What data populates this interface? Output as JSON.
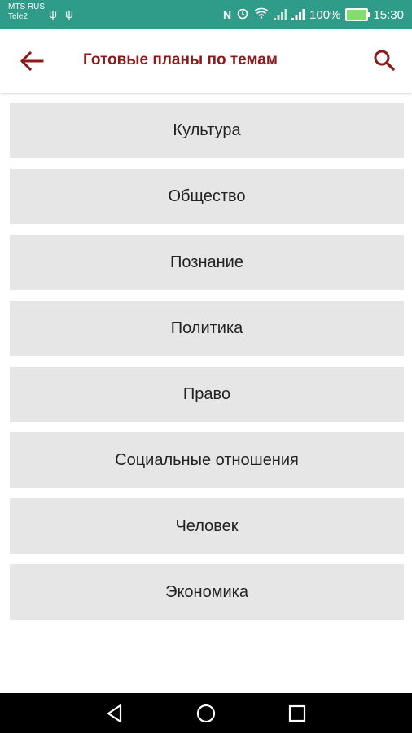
{
  "status_bar": {
    "carrier_line1": "MTS RUS",
    "carrier_line2": "Tele2",
    "battery": "100%",
    "time": "15:30",
    "icons": [
      "usb-icon",
      "usb-icon",
      "nfc-icon",
      "alarm-icon",
      "wifi-icon",
      "signal-icon",
      "signal-icon",
      "battery-icon"
    ]
  },
  "app_bar": {
    "title": "Готовые планы по темам",
    "back_icon": "back-arrow-icon",
    "search_icon": "search-icon",
    "accent_color": "#8b1a1a"
  },
  "topics": [
    "Культура",
    "Общество",
    "Познание",
    "Политика",
    "Право",
    "Социальные отношения",
    "Человек",
    "Экономика"
  ],
  "nav_bar": {
    "icons": [
      "nav-back-icon",
      "nav-home-icon",
      "nav-recents-icon"
    ]
  },
  "colors": {
    "status_bar": "#2e9c88",
    "list_item_bg": "#e6e6e6"
  }
}
